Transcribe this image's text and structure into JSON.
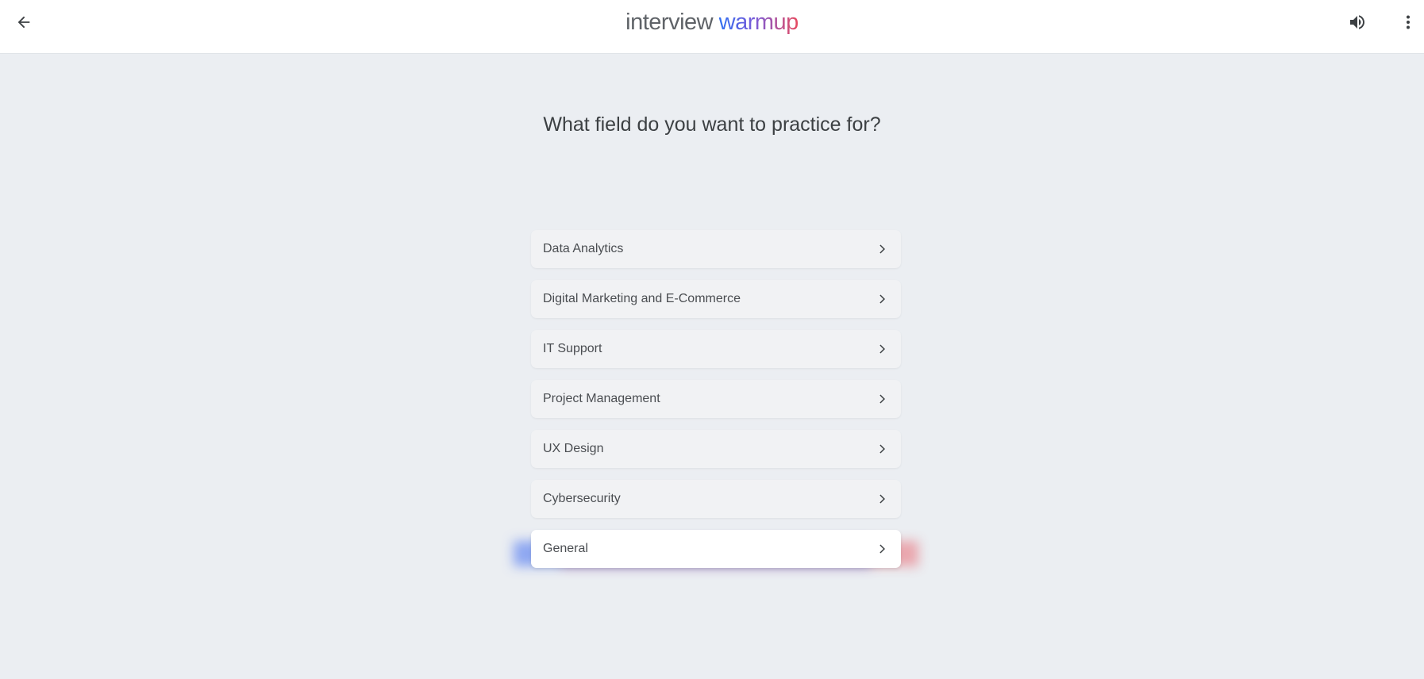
{
  "header": {
    "logo_part1": "interview ",
    "logo_part2": "warmup",
    "back_icon": "arrow-left-icon",
    "sound_icon": "volume-up-icon",
    "more_icon": "more-vertical-icon"
  },
  "main": {
    "title": "What field do you want to practice for?",
    "options": [
      {
        "label": "Data Analytics"
      },
      {
        "label": "Digital Marketing and E-Commerce"
      },
      {
        "label": "IT Support"
      },
      {
        "label": "Project Management"
      },
      {
        "label": "UX Design"
      },
      {
        "label": "Cybersecurity"
      },
      {
        "label": "General"
      }
    ]
  },
  "colors": {
    "accent_blue": "#2f6ff2",
    "accent_red": "#e84a5f",
    "background": "#ebeef2"
  }
}
